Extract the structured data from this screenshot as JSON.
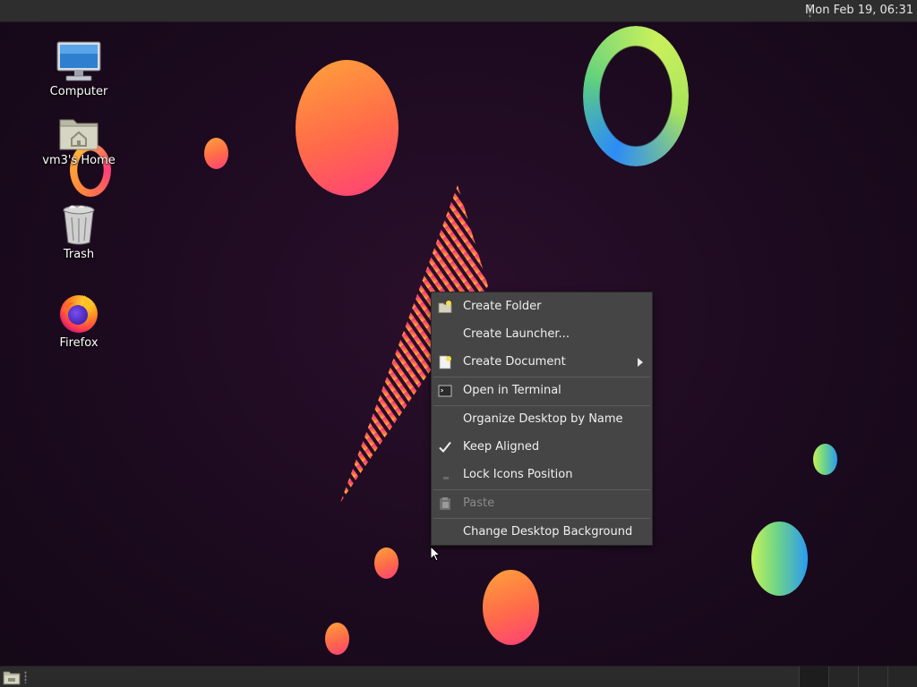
{
  "top_panel": {
    "clock": "Mon Feb 19, 06:31"
  },
  "desktop_icons": [
    {
      "label": "Computer",
      "icon": "computer-icon"
    },
    {
      "label": "vm3's Home",
      "icon": "home-folder-icon"
    },
    {
      "label": "Trash",
      "icon": "trash-icon"
    },
    {
      "label": "Firefox",
      "icon": "firefox-icon"
    }
  ],
  "context_menu": {
    "items": [
      {
        "label": "Create Folder",
        "icon": "folder-new-icon",
        "enabled": true
      },
      {
        "label": "Create Launcher...",
        "icon": "",
        "enabled": true
      },
      {
        "label": "Create Document",
        "icon": "document-new-icon",
        "enabled": true,
        "submenu": true
      },
      {
        "label": "Open in Terminal",
        "icon": "terminal-icon",
        "enabled": true
      },
      {
        "label": "Organize Desktop by Name",
        "icon": "",
        "enabled": true
      },
      {
        "label": "Keep Aligned",
        "icon": "check-icon",
        "enabled": true,
        "checked": true
      },
      {
        "label": "Lock Icons Position",
        "icon": "lock-icon",
        "enabled": true
      },
      {
        "label": "Paste",
        "icon": "paste-icon",
        "enabled": false
      },
      {
        "label": "Change Desktop Background",
        "icon": "",
        "enabled": true
      }
    ]
  },
  "bottom_panel": {
    "show_desktop_icon": "show-desktop-icon",
    "workspaces": 4,
    "active_workspace": 1
  },
  "colors": {
    "background": "#1c0a1f",
    "menu_bg": "#454545",
    "panel_bg": "#2e2e2e",
    "accent_orange": "#ff8a3a",
    "accent_pink": "#ff3f7a",
    "accent_green": "#6fd486",
    "accent_blue": "#2a9bf2"
  }
}
